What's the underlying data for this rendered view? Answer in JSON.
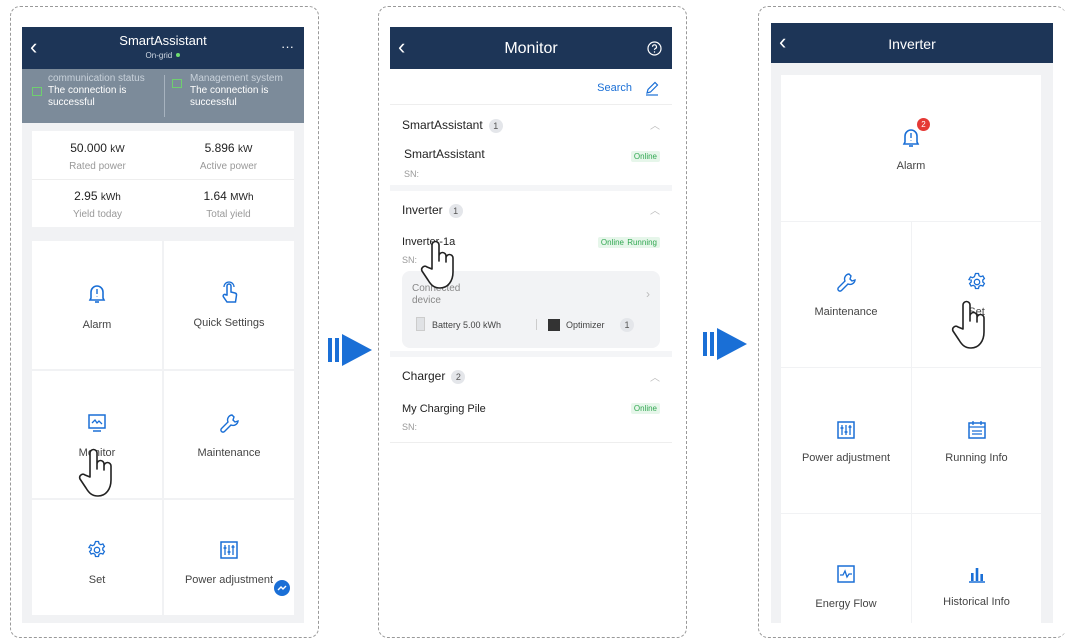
{
  "screen1": {
    "title": "SmartAssistant",
    "subtitle": "On-grid",
    "more": "···",
    "comm_label": "communication status",
    "comm_value": "The connection is successful",
    "mgmt_label": "Management system",
    "mgmt_value": "The connection is successful",
    "stats": [
      {
        "value": "50.000",
        "unit": "kW",
        "label": "Rated power"
      },
      {
        "value": "5.896",
        "unit": "kW",
        "label": "Active power"
      },
      {
        "value": "2.95",
        "unit": "kWh",
        "label": "Yield today"
      },
      {
        "value": "1.64",
        "unit": "MWh",
        "label": "Total yield"
      }
    ],
    "tiles": [
      "Alarm",
      "Quick Settings",
      "Monitor",
      "Maintenance",
      "Set",
      "Power adjustment"
    ]
  },
  "screen2": {
    "title": "Monitor",
    "search": "Search",
    "sections": [
      {
        "name": "SmartAssistant",
        "count": "1"
      },
      {
        "name": "Inverter",
        "count": "1"
      },
      {
        "name": "Charger",
        "count": "2"
      }
    ],
    "devices": [
      {
        "name": "SmartAssistant",
        "sn": "SN:",
        "status": "Online"
      },
      {
        "name": "Inverter-1a",
        "sn": "SN:",
        "status": "Online",
        "status2": "Running"
      },
      {
        "name": "My Charging Pile",
        "sn": "SN:",
        "status": "Online"
      }
    ],
    "connected_label": "Connected device",
    "battery_label": "Battery 5.00 kWh",
    "optimizer_label": "Optimizer",
    "optimizer_count": "1"
  },
  "screen3": {
    "title": "Inverter",
    "alarm_label": "Alarm",
    "alarm_count": "2",
    "tiles": [
      "Maintenance",
      "Set",
      "Power adjustment",
      "Running Info",
      "Energy Flow",
      "Historical Info"
    ]
  },
  "colors": {
    "navbar": "#1d3557",
    "accent": "#1a6fd6",
    "online": "#32a852"
  }
}
